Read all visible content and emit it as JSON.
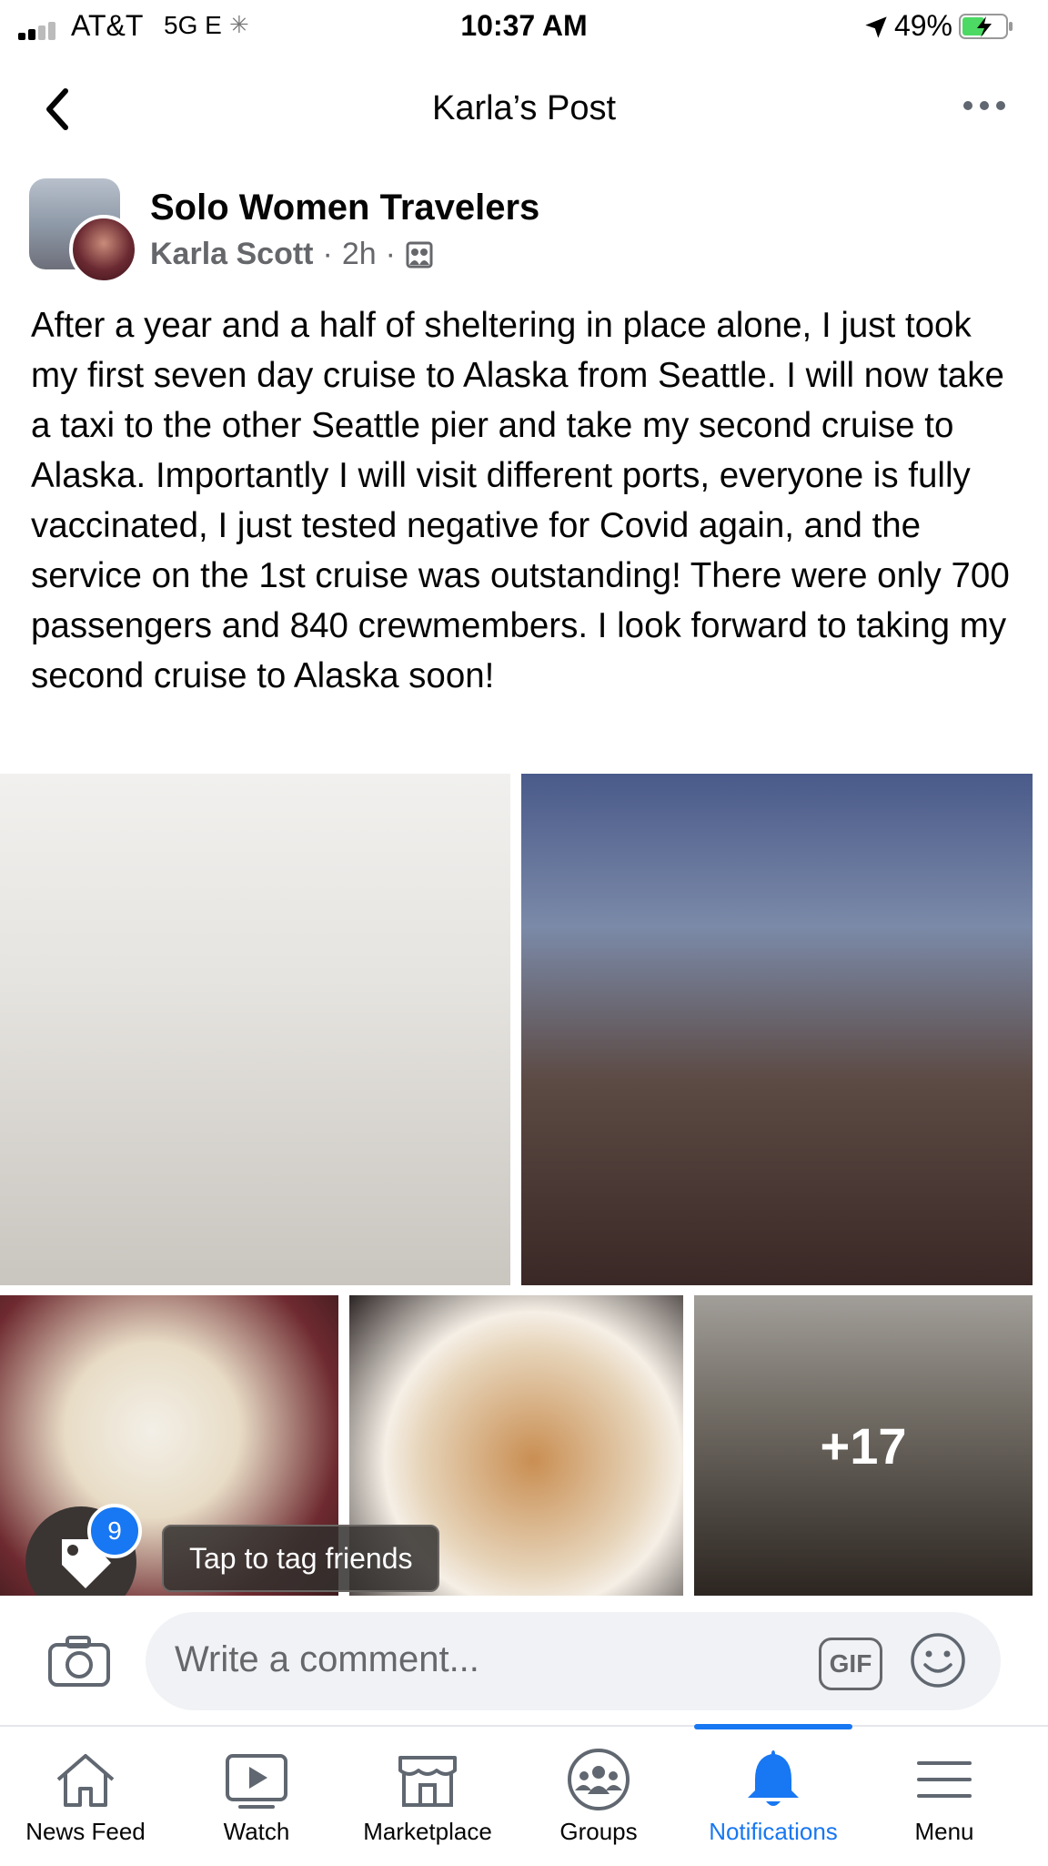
{
  "status_bar": {
    "carrier": "AT&T",
    "network": "5G E",
    "time": "10:37 AM",
    "battery": "49%",
    "icons": [
      "signal-icon",
      "loading-icon",
      "location-arrow-icon",
      "battery-charging-icon"
    ]
  },
  "header": {
    "title": "Karla’s Post",
    "icons": [
      "back-arrow-icon",
      "more-options-icon"
    ]
  },
  "post": {
    "group_name": "Solo Women Travelers",
    "author": "Karla Scott",
    "separator": "·",
    "time": "2h",
    "audience_icon": "group-icon",
    "text": "After a year and a half of sheltering in place alone, I just took my first seven day cruise to Alaska from Seattle. I will now take a taxi to the other Seattle pier and take my second cruise to Alaska. Importantly I will visit different ports, everyone is fully vaccinated, I just tested negative for Covid again, and the service on the 1st cruise was outstanding! There were only 700 passengers and 840 crewmembers. I look forward to taking my second cruise to Alaska soon!",
    "photos_more": "+17",
    "tag_badge": "9",
    "tag_tooltip": "Tap to tag friends"
  },
  "comment": {
    "placeholder": "Write a comment...",
    "gif_label": "GIF",
    "icons": [
      "camera-icon",
      "gif-icon",
      "emoji-icon"
    ]
  },
  "tab_bar": {
    "tabs": [
      {
        "label": "News Feed",
        "icon": "home-icon"
      },
      {
        "label": "Watch",
        "icon": "video-icon"
      },
      {
        "label": "Marketplace",
        "icon": "shop-icon"
      },
      {
        "label": "Groups",
        "icon": "groups-icon"
      },
      {
        "label": "Notifications",
        "icon": "bell-icon",
        "active": true
      },
      {
        "label": "Menu",
        "icon": "hamburger-icon"
      }
    ],
    "active_color": "#1877f2"
  }
}
